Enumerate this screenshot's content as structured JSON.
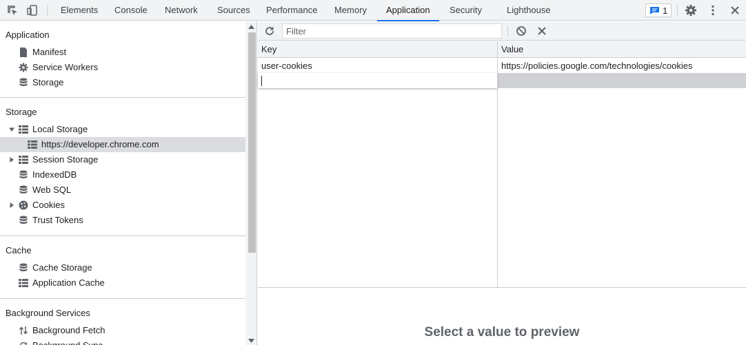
{
  "tabs": [
    "Elements",
    "Console",
    "Network",
    "Sources",
    "Performance",
    "Memory",
    "Application",
    "Security",
    "Lighthouse"
  ],
  "active_tab": "Application",
  "issues_badge": {
    "count": "1",
    "icon": "message-icon",
    "color": "#1a73e8"
  },
  "sidebar": {
    "application": {
      "title": "Application",
      "items": [
        {
          "label": "Manifest",
          "icon": "file-icon"
        },
        {
          "label": "Service Workers",
          "icon": "gear-icon"
        },
        {
          "label": "Storage",
          "icon": "database-icon"
        }
      ]
    },
    "storage": {
      "title": "Storage",
      "items": [
        {
          "label": "Local Storage",
          "icon": "grid-icon",
          "expanded": true
        },
        {
          "label": "https://developer.chrome.com",
          "icon": "grid-icon",
          "selected": true
        },
        {
          "label": "Session Storage",
          "icon": "grid-icon",
          "expanded": false
        },
        {
          "label": "IndexedDB",
          "icon": "database-icon"
        },
        {
          "label": "Web SQL",
          "icon": "database-icon"
        },
        {
          "label": "Cookies",
          "icon": "cookie-icon",
          "expanded": false
        },
        {
          "label": "Trust Tokens",
          "icon": "database-icon"
        }
      ]
    },
    "cache": {
      "title": "Cache",
      "items": [
        {
          "label": "Cache Storage",
          "icon": "database-icon"
        },
        {
          "label": "Application Cache",
          "icon": "grid-icon"
        }
      ]
    },
    "background": {
      "title": "Background Services",
      "items": [
        {
          "label": "Background Fetch",
          "icon": "arrows-icon"
        },
        {
          "label": "Background Sync",
          "icon": "sync-icon"
        }
      ]
    }
  },
  "toolbar": {
    "filter_placeholder": "Filter"
  },
  "table": {
    "columns": [
      "Key",
      "Value"
    ],
    "rows": [
      {
        "key": "user-cookies",
        "value": "https://policies.google.com/technologies/cookies"
      }
    ]
  },
  "preview": {
    "text": "Select a value to preview"
  },
  "colors": {
    "accent": "#1a73e8",
    "selection": "#dadce0"
  }
}
